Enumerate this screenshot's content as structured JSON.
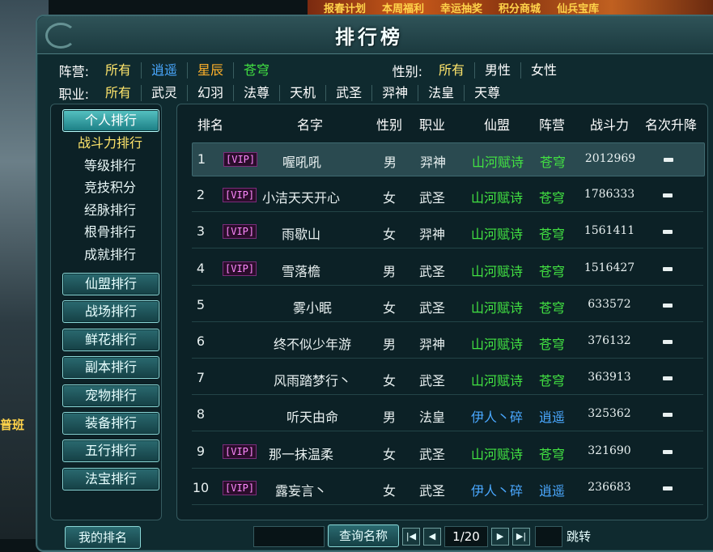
{
  "top_banner": [
    "报春计划",
    "本周福利",
    "幸运抽奖",
    "积分商城",
    "仙兵宝库"
  ],
  "side_text": "普班",
  "title": "排行榜",
  "filters": {
    "camp_label": "阵营:",
    "camp_options": [
      {
        "label": "所有",
        "color": "#ffffff"
      },
      {
        "label": "逍遥",
        "color": "#4aa8ff"
      },
      {
        "label": "星辰",
        "color": "#ffb12a"
      },
      {
        "label": "苍穹",
        "color": "#42e242"
      }
    ],
    "gender_label": "性别:",
    "gender_options": [
      {
        "label": "所有"
      },
      {
        "label": "男性"
      },
      {
        "label": "女性"
      }
    ],
    "job_label": "职业:",
    "job_options": [
      {
        "label": "所有"
      },
      {
        "label": "武灵"
      },
      {
        "label": "幻羽"
      },
      {
        "label": "法尊"
      },
      {
        "label": "天机"
      },
      {
        "label": "武圣"
      },
      {
        "label": "羿神"
      },
      {
        "label": "法皇"
      },
      {
        "label": "天尊"
      }
    ]
  },
  "sidebar": {
    "personal": "个人排行",
    "sub_items": [
      "战斗力排行",
      "等级排行",
      "竞技积分",
      "经脉排行",
      "根骨排行",
      "成就排行"
    ],
    "categories": [
      "仙盟排行",
      "战场排行",
      "鲜花排行",
      "副本排行",
      "宠物排行",
      "装备排行",
      "五行排行",
      "法宝排行"
    ]
  },
  "table": {
    "headers": [
      "排名",
      "名字",
      "性别",
      "职业",
      "仙盟",
      "阵营",
      "战斗力",
      "名次升降"
    ],
    "vip_label": "[VIP]",
    "rows": [
      {
        "rank": "1",
        "vip": true,
        "name": "喔吼吼",
        "gender": "男",
        "job": "羿神",
        "guild": "山河赋诗",
        "camp": "苍穹",
        "power": "2012969"
      },
      {
        "rank": "2",
        "vip": true,
        "name": "小洁天天开心",
        "gender": "女",
        "job": "武圣",
        "guild": "山河赋诗",
        "camp": "苍穹",
        "power": "1786333"
      },
      {
        "rank": "3",
        "vip": true,
        "name": "雨歇山",
        "gender": "女",
        "job": "羿神",
        "guild": "山河赋诗",
        "camp": "苍穹",
        "power": "1561411"
      },
      {
        "rank": "4",
        "vip": true,
        "name": "雪落檐",
        "gender": "男",
        "job": "武圣",
        "guild": "山河赋诗",
        "camp": "苍穹",
        "power": "1516427"
      },
      {
        "rank": "5",
        "vip": false,
        "name": "雾小眠",
        "gender": "女",
        "job": "武圣",
        "guild": "山河赋诗",
        "camp": "苍穹",
        "power": "633572"
      },
      {
        "rank": "6",
        "vip": false,
        "name": "终不似少年游",
        "gender": "男",
        "job": "羿神",
        "guild": "山河赋诗",
        "camp": "苍穹",
        "power": "376132"
      },
      {
        "rank": "7",
        "vip": false,
        "name": "风雨踏梦行丶",
        "gender": "女",
        "job": "武圣",
        "guild": "山河赋诗",
        "camp": "苍穹",
        "power": "363913"
      },
      {
        "rank": "8",
        "vip": false,
        "name": "听天由命",
        "gender": "男",
        "job": "法皇",
        "guild": "伊人丶碎",
        "camp": "逍遥",
        "power": "325362"
      },
      {
        "rank": "9",
        "vip": true,
        "name": "那一抹温柔",
        "gender": "女",
        "job": "武圣",
        "guild": "山河赋诗",
        "camp": "苍穹",
        "power": "321690"
      },
      {
        "rank": "10",
        "vip": true,
        "name": "露妄言丶",
        "gender": "女",
        "job": "武圣",
        "guild": "伊人丶碎",
        "camp": "逍遥",
        "power": "236683"
      }
    ]
  },
  "colors": {
    "green": "#42e242",
    "blue": "#4aa8ff"
  },
  "bottom": {
    "my_rank": "我的排名",
    "search_button": "查询名称",
    "page": "1/20",
    "jump_label": "跳转"
  }
}
